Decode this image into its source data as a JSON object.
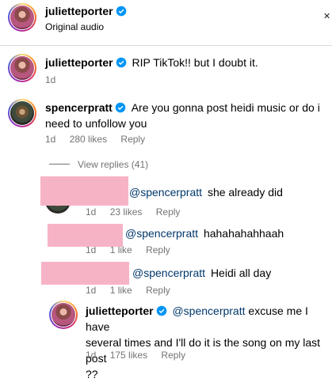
{
  "header": {
    "username": "julietteporter",
    "subtitle": "Original audio",
    "close_icon": "✕"
  },
  "comments": [
    {
      "username": "julietteporter",
      "text": "RIP TikTok!! but I doubt it.",
      "time": "1d"
    },
    {
      "username": "spencerpratt",
      "text": "Are you gonna post heidi music or do i need to unfollow you",
      "time": "1d",
      "likes": "280 likes",
      "reply": "Reply"
    }
  ],
  "view_replies": "View replies (41)",
  "replies": [
    {
      "mention": "@spencerpratt",
      "text": "she already did",
      "time": "1d",
      "likes": "23 likes",
      "reply": "Reply"
    },
    {
      "mention": "@spencerpratt",
      "text": "hahahahahhaah",
      "time": "1d",
      "likes": "1 like",
      "reply": "Reply"
    },
    {
      "mention": "@spencerpratt",
      "text": "Heidi all day",
      "time": "1d",
      "likes": "1 like",
      "reply": "Reply"
    },
    {
      "username": "julietteporter",
      "mention": "@spencerpratt",
      "text_line1": "excuse me I have",
      "text_line2": "several times and I'll do it is the song on my last post",
      "text_line3": "??",
      "time": "1d",
      "likes": "175 likes",
      "reply": "Reply"
    }
  ],
  "colors": {
    "verified": "#0095f6",
    "meta": "#737373",
    "mention": "#00376b",
    "redaction": "#f7b3c6"
  }
}
